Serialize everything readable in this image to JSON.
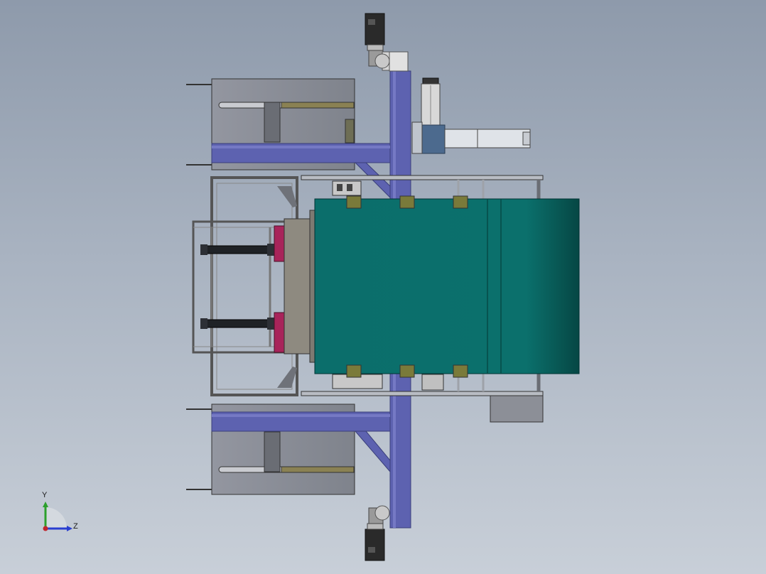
{
  "viewport": {
    "background_top": "#8e9aab",
    "background_bottom": "#c8cfd8"
  },
  "colors": {
    "frame_blue": "#5d62b0",
    "frame_blue_edge": "#3a3f7a",
    "gray_housing": "#8c8f97",
    "teal_drum": "#0b6e6b",
    "teal_drum_dark": "#07504e",
    "magenta_part": "#a8245a",
    "olive_roller": "#7a7a3a",
    "motor_black": "#2a2a2a",
    "steel_blue": "#4c6a8e"
  },
  "triad": {
    "y_label": "Y",
    "z_label": "Z",
    "y_color": "#2ca02c",
    "z_color": "#2a3fd0",
    "x_color": "#c0262d"
  }
}
